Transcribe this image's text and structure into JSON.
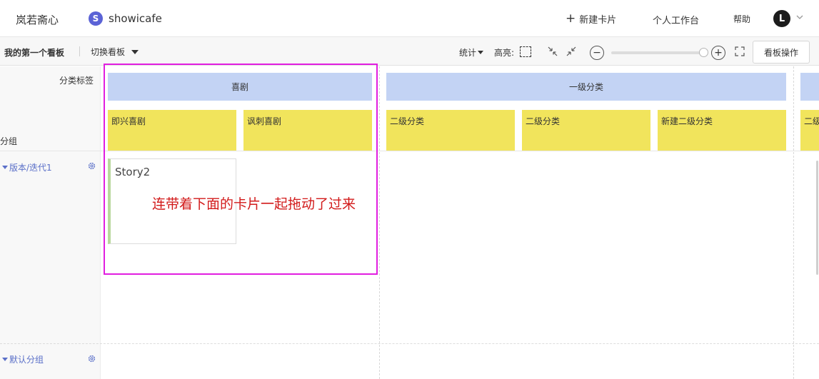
{
  "header": {
    "brand": "岚若斋心",
    "project_initial": "S",
    "project_name": "showicafe",
    "new_card_label": "新建卡片",
    "workspace_label": "个人工作台",
    "help_label": "帮助",
    "user_initial": "L"
  },
  "toolbar": {
    "board_name": "我的第一个看板",
    "switch_board": "切换看板",
    "stats": "统计",
    "highlight": "高亮:",
    "zoom_level": 0.97,
    "board_ops": "看板操作"
  },
  "board": {
    "category_label": "分类标签",
    "group_label": "分组",
    "categories": [
      {
        "name": "喜剧",
        "subs": [
          "即兴喜剧",
          "讽刺喜剧"
        ]
      },
      {
        "name": "一级分类",
        "subs": [
          "二级分类",
          "二级分类",
          "新建二级分类"
        ]
      },
      {
        "name": "",
        "subs": [
          "二级"
        ]
      }
    ],
    "groups": [
      {
        "name": "版本/迭代1"
      },
      {
        "name": "默认分组"
      }
    ],
    "cards": [
      {
        "title": "Story2"
      }
    ]
  },
  "annotation": {
    "text": "连带着下面的卡片一起拖动了过来"
  },
  "colors": {
    "category_header": "#c3d3f4",
    "sub_header": "#f1e45c",
    "annotation_border": "#e11ee0",
    "annotation_text": "#d21a1a",
    "group_link": "#5a6fc8",
    "card_accent": "#b9d89d"
  }
}
